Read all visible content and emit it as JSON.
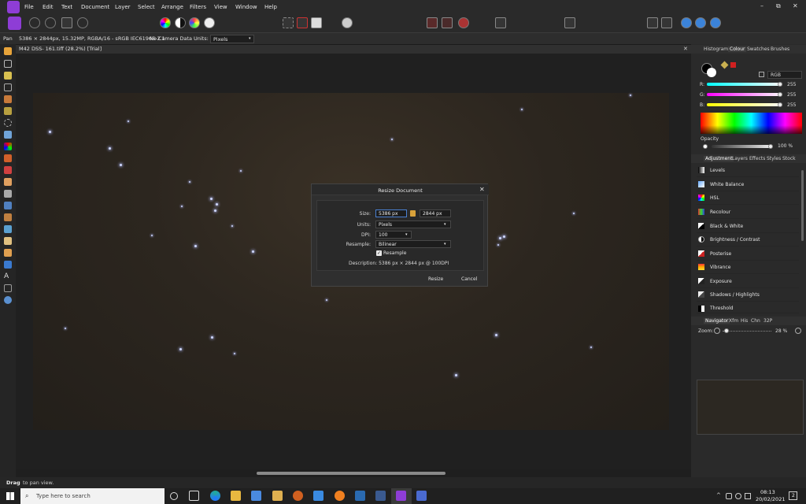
{
  "menubar": {
    "items": [
      "File",
      "Edit",
      "Text",
      "Document",
      "Layer",
      "Select",
      "Arrange",
      "Filters",
      "View",
      "Window",
      "Help"
    ],
    "window_controls": [
      "–",
      "⧉",
      "✕"
    ]
  },
  "context": {
    "tool_name": "Pan",
    "doc_info": "5386 × 2844px, 15.32MP, RGBA/16 - sRGB IEC61966-2.1",
    "camera": "No Camera Data",
    "units_label": "Units:",
    "units_value": "Pixels"
  },
  "document": {
    "tab_title": "M42 DSS- 161.tiff (28.2%) [Trial]"
  },
  "dialog": {
    "title": "Resize Document",
    "close": "✕",
    "size_label": "Size:",
    "width": "5386 px",
    "height": "2844 px",
    "units_label": "Units:",
    "units_value": "Pixels",
    "dpi_label": "DPI:",
    "dpi_value": "100",
    "resample_label": "Resample:",
    "resample_value": "Bilinear",
    "resample_check_label": "Resample",
    "resample_checked": true,
    "description": "Description: 5386 px × 2844 px @ 100DPI",
    "resize_button": "Resize",
    "cancel_button": "Cancel"
  },
  "colour_panel": {
    "tabs": [
      "Histogram",
      "Colour",
      "Swatches",
      "Brushes"
    ],
    "active_tab": "Colour",
    "model": "RGB",
    "r_label": "R:",
    "r_value": "255",
    "g_label": "G:",
    "g_value": "255",
    "b_label": "B:",
    "b_value": "255",
    "opacity_label": "Opacity",
    "opacity_value": "100 %"
  },
  "adjustment_panel": {
    "tabs": [
      "Adjustment",
      "Layers",
      "Effects",
      "Styles",
      "Stock"
    ],
    "active_tab": "Adjustment",
    "items": [
      "Levels",
      "White Balance",
      "HSL",
      "Recolour",
      "Black & White",
      "Brightness / Contrast",
      "Posterise",
      "Vibrance",
      "Exposure",
      "Shadows / Highlights",
      "Threshold"
    ]
  },
  "navigator_panel": {
    "tabs": [
      "Navigator",
      "Xfm",
      "His",
      "Chn",
      "32P"
    ],
    "active_tab": "Navigator",
    "zoom_label": "Zoom:",
    "zoom_value": "28 %"
  },
  "status": {
    "bold": "Drag",
    "text": "to pan view."
  },
  "taskbar": {
    "search_placeholder": "Type here to search",
    "time": "08:13",
    "date": "20/02/2021",
    "notification_count": "2"
  },
  "colors": {
    "accent": "#8e3dd6",
    "focus": "#4a7fd0"
  }
}
